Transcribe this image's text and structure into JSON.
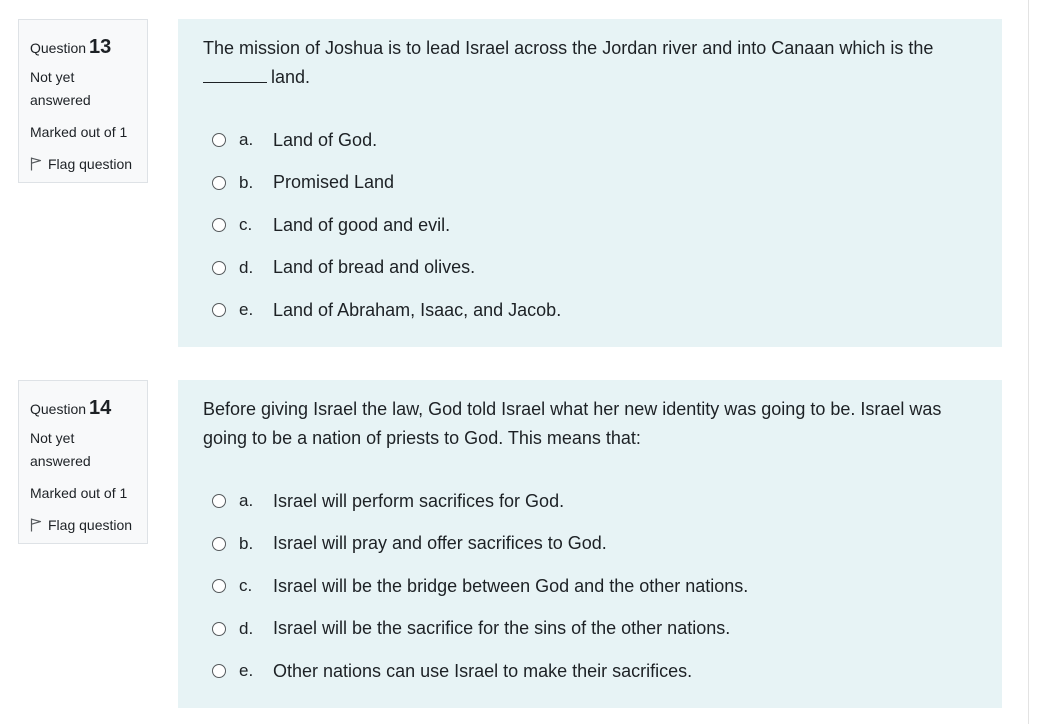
{
  "questions": [
    {
      "label": "Question",
      "number": "13",
      "state": "Not yet answered",
      "grade": "Marked out of 1",
      "flag_label": "Flag question",
      "text_after_blank": "land.",
      "text_before_blank": "The mission of Joshua is to lead Israel across the Jordan river and into Canaan which is the",
      "answers": [
        {
          "letter": "a.",
          "text": "Land of God."
        },
        {
          "letter": "b.",
          "text": "Promised Land"
        },
        {
          "letter": "c.",
          "text": "Land of good and evil."
        },
        {
          "letter": "d.",
          "text": "Land of bread and olives."
        },
        {
          "letter": "e.",
          "text": "Land of Abraham, Isaac, and Jacob."
        }
      ]
    },
    {
      "label": "Question",
      "number": "14",
      "state": "Not yet answered",
      "grade": "Marked out of 1",
      "flag_label": "Flag question",
      "text": "Before giving Israel the law, God told Israel what her new identity was going to be. Israel was going to be a nation of priests to God. This means that:",
      "answers": [
        {
          "letter": "a.",
          "text": "Israel will perform sacrifices for God."
        },
        {
          "letter": "b.",
          "text": "Israel will pray and offer sacrifices to God."
        },
        {
          "letter": "c.",
          "text": "Israel will be the bridge between God and the other nations."
        },
        {
          "letter": "d.",
          "text": "Israel will be the sacrifice for the sins of the other nations."
        },
        {
          "letter": "e.",
          "text": "Other nations can use Israel to make their sacrifices."
        }
      ]
    }
  ],
  "colors": {
    "info_bg": "#f8f9fa",
    "content_bg": "#e7f3f5",
    "text": "#1d2125"
  },
  "icons": {
    "flag": "flag-outline-icon",
    "radio": "radio-unchecked-icon"
  }
}
